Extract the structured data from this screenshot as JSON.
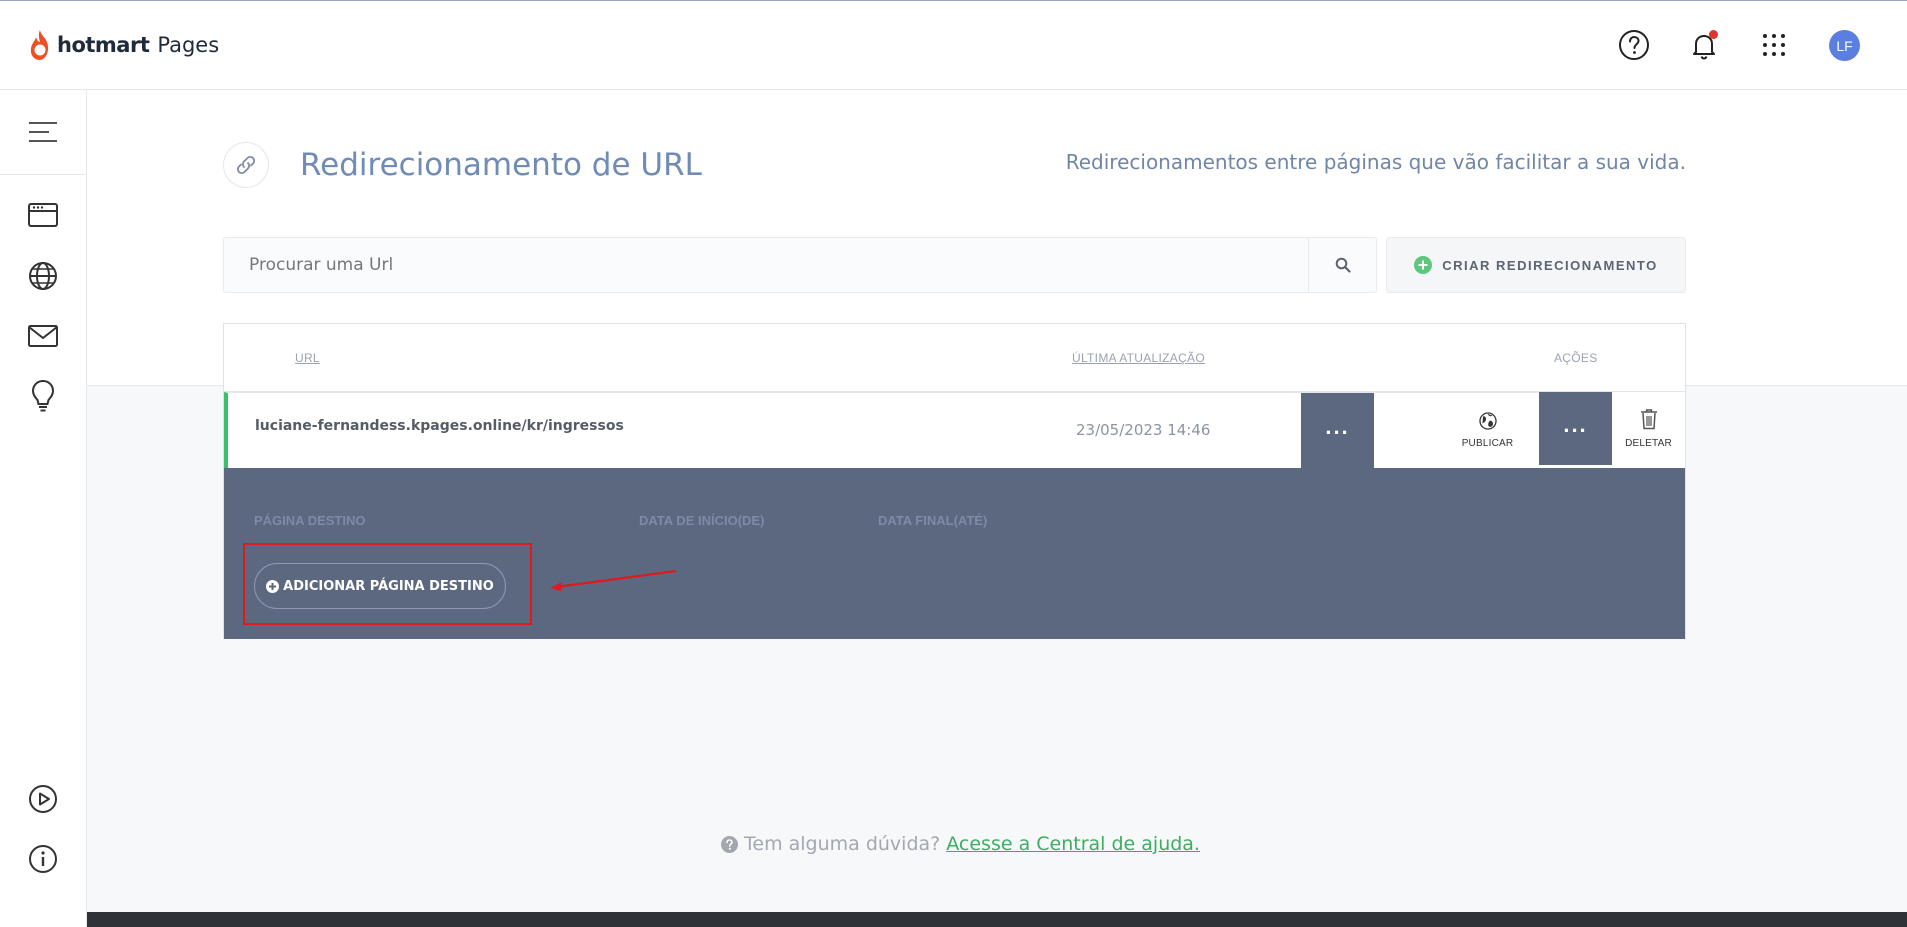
{
  "app": {
    "brand": "hotmart",
    "product": "Pages",
    "avatar_initials": "LF"
  },
  "page": {
    "title": "Redirecionamento de URL",
    "subtitle": "Redirecionamentos entre páginas que vão facilitar a sua vida."
  },
  "search": {
    "placeholder": "Procurar uma Url",
    "value": ""
  },
  "create_button": {
    "label": "CRIAR REDIRECIONAMENTO"
  },
  "table": {
    "columns": [
      "URL",
      "ÚLTIMA ATUALIZAÇÃO",
      "AÇÕES"
    ],
    "rows": [
      {
        "url": "luciane-fernandess.kpages.online/kr/ingressos",
        "updated": "23/05/2023 14:46",
        "actions": {
          "publish": "PUBLICAR",
          "delete": "DELETAR"
        }
      }
    ],
    "detail": {
      "columns": [
        "PÁGINA DESTINO",
        "DATA DE INÍCIO(DE)",
        "DATA FINAL(ATÉ)"
      ],
      "add_button": "ADICIONAR PÁGINA DESTINO"
    }
  },
  "help": {
    "text": "Tem alguma dúvida?",
    "link": "Acesse a Central de ajuda."
  },
  "colors": {
    "accent_green": "#3cbf6a",
    "detail_bg": "#5c6780",
    "highlight_red": "#e0191c",
    "title_blue": "#6f8bb6"
  }
}
